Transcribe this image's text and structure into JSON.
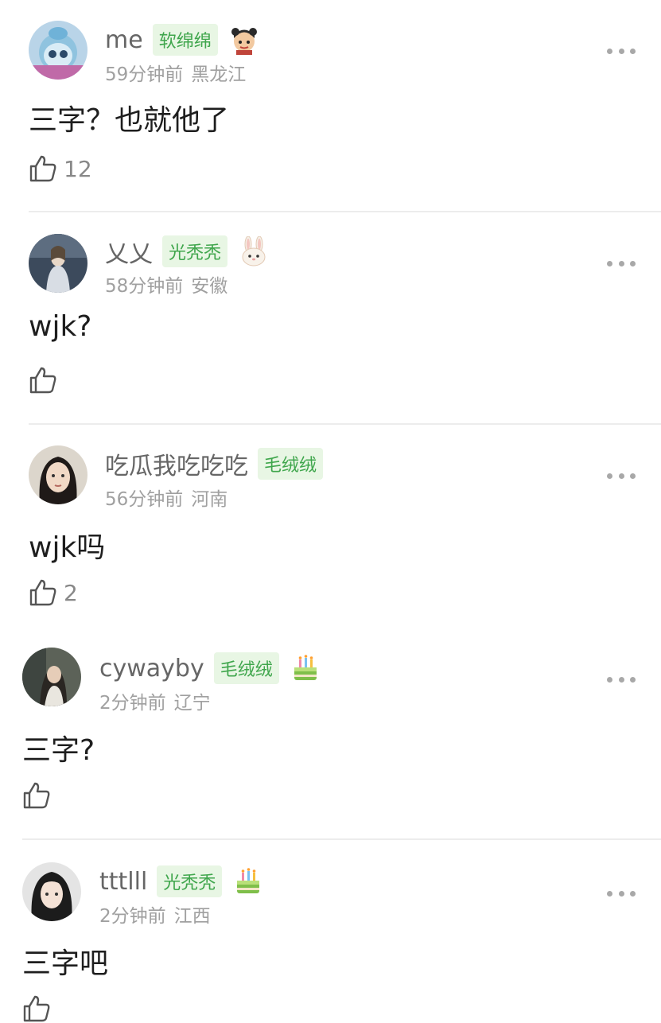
{
  "colors": {
    "badge_text": "#3fa64c",
    "badge_bg": "#e8f6e4",
    "meta": "#a0a0a0"
  },
  "comments": [
    {
      "username": "me",
      "badge": "软绵绵",
      "emoji": "boy-emoji-icon",
      "time": "59分钟前",
      "location": "黑龙江",
      "text": "三字？也就他了",
      "likes": "12"
    },
    {
      "username": "乂乂",
      "badge": "光秃秃",
      "emoji": "rabbit-emoji-icon",
      "time": "58分钟前",
      "location": "安徽",
      "text": "wjk?",
      "likes": ""
    },
    {
      "username": "吃瓜我吃吃吃",
      "badge": "毛绒绒",
      "emoji": "",
      "time": "56分钟前",
      "location": "河南",
      "text": "wjk吗",
      "likes": "2"
    },
    {
      "username": "cywayby",
      "badge": "毛绒绒",
      "emoji": "cake-emoji-icon",
      "time": "2分钟前",
      "location": "辽宁",
      "text": "三字?",
      "likes": ""
    },
    {
      "username": "tttlll",
      "badge": "光秃秃",
      "emoji": "cake-emoji-icon",
      "time": "2分钟前",
      "location": "江西",
      "text": "三字吧",
      "likes": ""
    }
  ]
}
